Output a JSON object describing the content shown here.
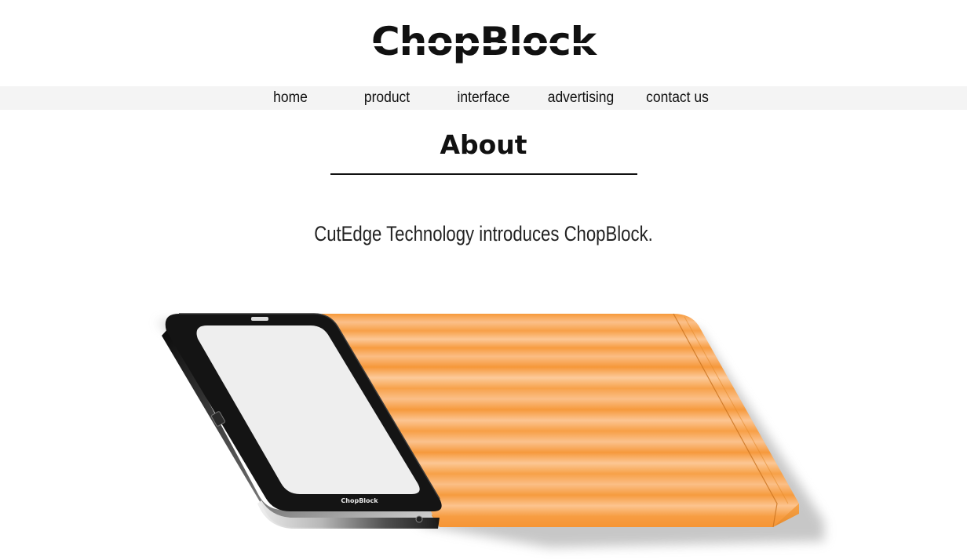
{
  "header": {
    "logo_text": "ChopBlock"
  },
  "nav": {
    "items": [
      {
        "label": "home"
      },
      {
        "label": "product"
      },
      {
        "label": "interface"
      },
      {
        "label": "advertising"
      },
      {
        "label": "contact us"
      }
    ]
  },
  "about": {
    "title": "About",
    "intro": "CutEdge Technology introduces ChopBlock."
  },
  "product_image": {
    "device_brand_text": "ChopBlock",
    "colors": {
      "board": "#f7a64a",
      "frame": "#111111",
      "screen": "#eeeeee"
    }
  }
}
